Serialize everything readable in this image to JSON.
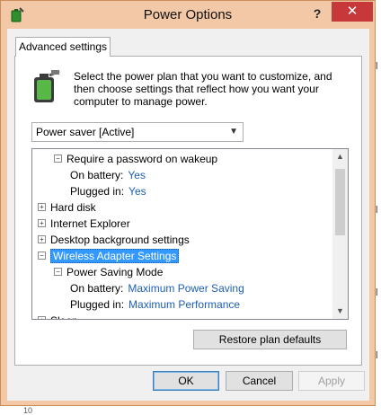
{
  "window": {
    "title": "Power Options",
    "help_glyph": "?",
    "close_glyph": "✕"
  },
  "tab": {
    "label": "Advanced settings"
  },
  "description": "Select the power plan that you want to customize, and then choose settings that reflect how you want your computer to manage power.",
  "plan_dropdown": {
    "value": "Power saver [Active]"
  },
  "tree": {
    "rows": [
      {
        "indent": 1,
        "expander": "−",
        "label": "Require a password on wakeup",
        "value": ""
      },
      {
        "indent": 2,
        "expander": "",
        "label": "On battery:",
        "value": "Yes"
      },
      {
        "indent": 2,
        "expander": "",
        "label": "Plugged in:",
        "value": "Yes"
      },
      {
        "indent": 0,
        "expander": "+",
        "label": "Hard disk",
        "value": ""
      },
      {
        "indent": 0,
        "expander": "+",
        "label": "Internet Explorer",
        "value": ""
      },
      {
        "indent": 0,
        "expander": "+",
        "label": "Desktop background settings",
        "value": ""
      },
      {
        "indent": 0,
        "expander": "−",
        "label": "Wireless Adapter Settings",
        "value": "",
        "selected": true
      },
      {
        "indent": 1,
        "expander": "−",
        "label": "Power Saving Mode",
        "value": ""
      },
      {
        "indent": 2,
        "expander": "",
        "label": "On battery:",
        "value": "Maximum Power Saving"
      },
      {
        "indent": 2,
        "expander": "",
        "label": "Plugged in:",
        "value": "Maximum Performance"
      },
      {
        "indent": 0,
        "expander": "+",
        "label": "Sleep",
        "value": ""
      }
    ]
  },
  "buttons": {
    "restore": "Restore plan defaults",
    "ok": "OK",
    "cancel": "Cancel",
    "apply": "Apply"
  },
  "background_marks": [
    "l",
    "l",
    "l",
    "l",
    "10"
  ],
  "colors": {
    "title_bar": "#f3c8a6",
    "close": "#c7383a",
    "selection": "#3399ff",
    "value_text": "#1d5fb4"
  }
}
